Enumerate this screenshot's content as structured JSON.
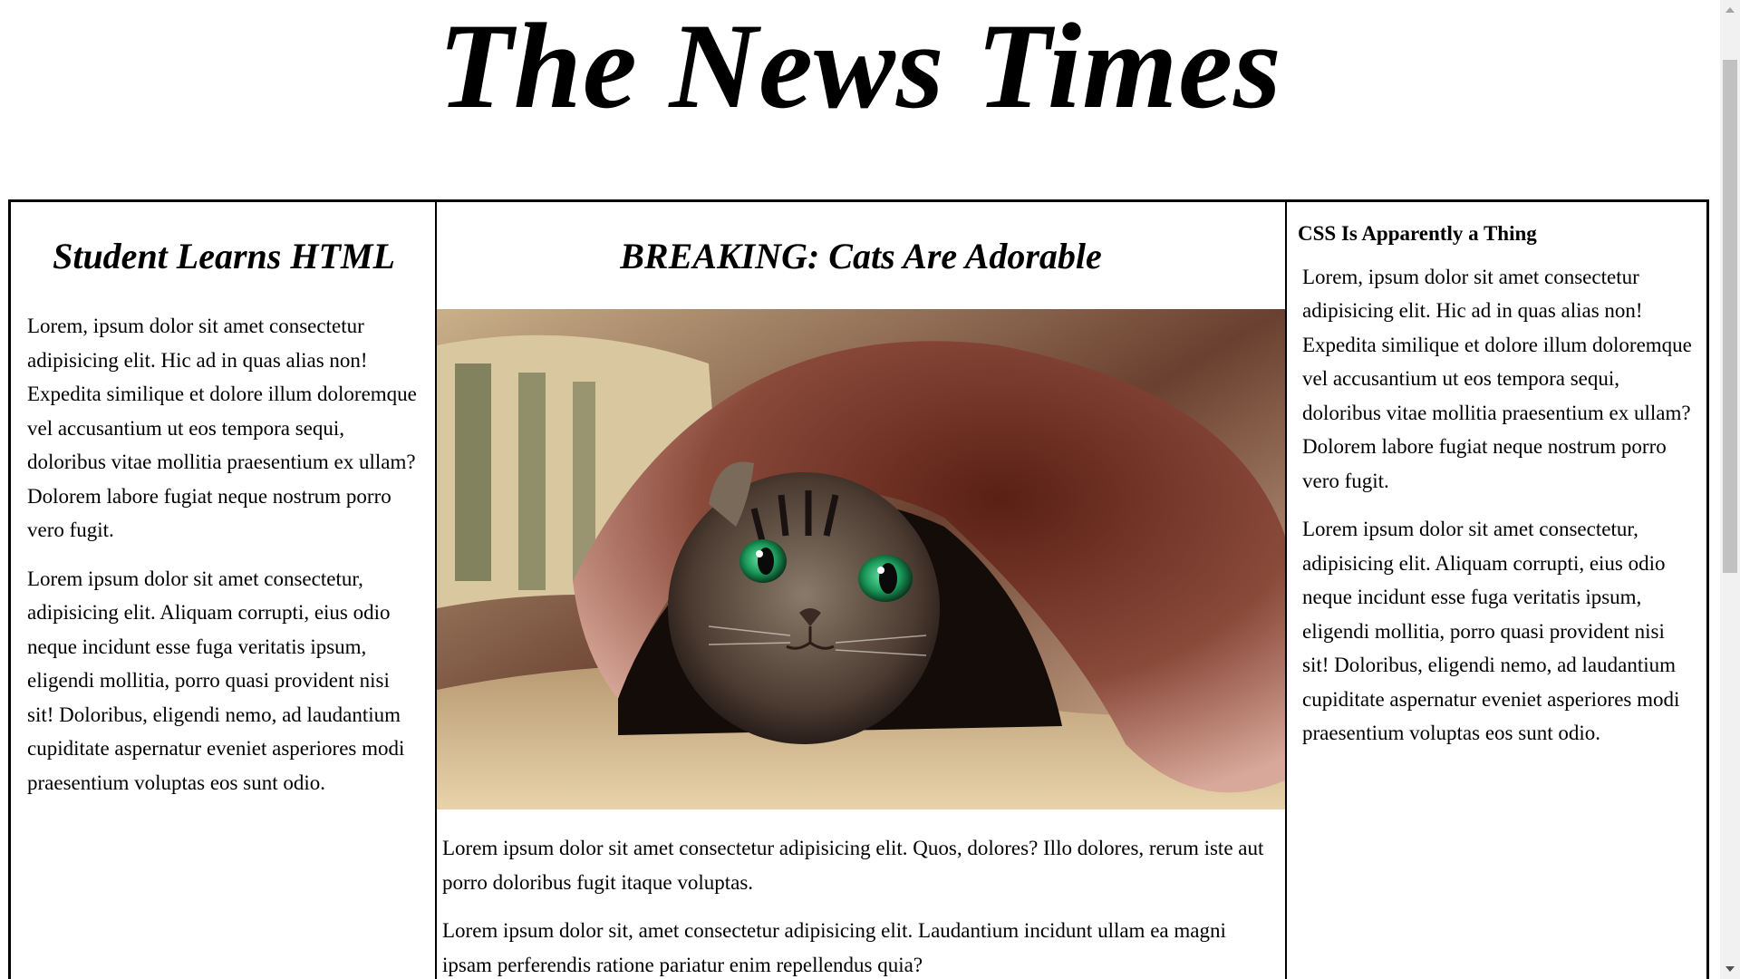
{
  "masthead": {
    "title": "The News Times"
  },
  "articles": {
    "left": {
      "headline": "Student Learns HTML",
      "paragraphs": [
        "Lorem, ipsum dolor sit amet consectetur adipisicing elit. Hic ad in quas alias non! Expedita similique et dolore illum doloremque vel accusantium ut eos tempora sequi, doloribus vitae mollitia praesentium ex ullam? Dolorem labore fugiat neque nostrum porro vero fugit.",
        "Lorem ipsum dolor sit amet consectetur, adipisicing elit. Aliquam corrupti, eius odio neque incidunt esse fuga veritatis ipsum, eligendi mollitia, porro quasi provident nisi sit! Doloribus, eligendi nemo, ad laudantium cupiditate aspernatur eveniet asperiores modi praesentium voluptas eos sunt odio."
      ]
    },
    "middle": {
      "headline": "BREAKING: Cats Are Adorable",
      "image_label": "cat-under-blanket-photo",
      "paragraphs": [
        "Lorem ipsum dolor sit amet consectetur adipisicing elit. Quos, dolores? Illo dolores, rerum iste aut porro doloribus fugit itaque voluptas.",
        "Lorem ipsum dolor sit, amet consectetur adipisicing elit. Laudantium incidunt ullam ea magni ipsam perferendis ratione pariatur enim repellendus quia?"
      ]
    },
    "right": {
      "headline": "CSS Is Apparently a Thing",
      "paragraphs": [
        "Lorem, ipsum dolor sit amet consectetur adipisicing elit. Hic ad in quas alias non! Expedita similique et dolore illum doloremque vel accusantium ut eos tempora sequi, doloribus vitae mollitia praesentium ex ullam? Dolorem labore fugiat neque nostrum porro vero fugit.",
        "Lorem ipsum dolor sit amet consectetur, adipisicing elit. Aliquam corrupti, eius odio neque incidunt esse fuga veritatis ipsum, eligendi mollitia, porro quasi provident nisi sit! Doloribus, eligendi nemo, ad laudantium cupiditate aspernatur eveniet asperiores modi praesentium voluptas eos sunt odio."
      ]
    }
  },
  "colors": {
    "border": "#000000",
    "background": "#ffffff",
    "scrollbar_track": "#f1f1f1",
    "scrollbar_thumb": "#c1c1c1"
  },
  "icons": {
    "scroll_up": "scroll-up-arrow-icon",
    "scroll_down": "scroll-down-arrow-icon"
  }
}
